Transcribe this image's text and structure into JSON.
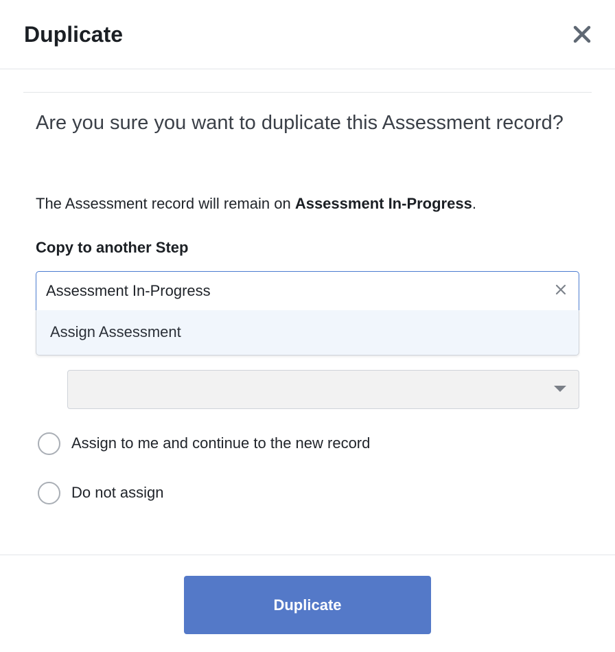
{
  "dialog": {
    "title": "Duplicate",
    "close_icon": "close-icon"
  },
  "content": {
    "question": "Are you sure you want to duplicate this Assessment record?",
    "remain_prefix": "The Assessment record will remain on ",
    "remain_step": "Assessment In-Progress",
    "remain_suffix": "."
  },
  "copy_step": {
    "label": "Copy to another Step",
    "selected_value": "Assessment In-Progress",
    "clear_icon": "clear-icon",
    "options": [
      "Assign Assessment"
    ]
  },
  "assignee_select": {
    "value": "",
    "disabled": true,
    "caret_icon": "caret-down-icon"
  },
  "assign_options": [
    {
      "label": "Assign to me and continue to the new record",
      "checked": false
    },
    {
      "label": "Do not assign",
      "checked": false
    }
  ],
  "footer": {
    "primary_label": "Duplicate"
  },
  "colors": {
    "primary": "#5479c8",
    "focus_border": "#4a7bd0",
    "option_highlight": "#f1f6fc"
  }
}
